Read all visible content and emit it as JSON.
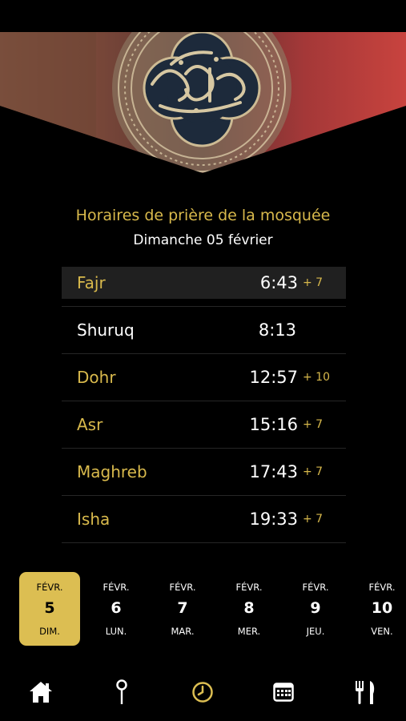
{
  "status_bar": {
    "time": ""
  },
  "header": {
    "title": "Horaires de prière de la mosquée",
    "date": "Dimanche 05 février"
  },
  "prayers": [
    {
      "name": "Fajr",
      "time": "6:43",
      "offset": "+ 7",
      "highlighted": true,
      "color": "#d8b94c"
    },
    {
      "name": "Shuruq",
      "time": "8:13",
      "offset": "",
      "highlighted": false,
      "color": "#ffffff"
    },
    {
      "name": "Dohr",
      "time": "12:57",
      "offset": "+ 10",
      "highlighted": false,
      "color": "#d8b94c"
    },
    {
      "name": "Asr",
      "time": "15:16",
      "offset": "+ 7",
      "highlighted": false,
      "color": "#d8b94c"
    },
    {
      "name": "Maghreb",
      "time": "17:43",
      "offset": "+ 7",
      "highlighted": false,
      "color": "#d8b94c"
    },
    {
      "name": "Isha",
      "time": "19:33",
      "offset": "+ 7",
      "highlighted": false,
      "color": "#d8b94c"
    }
  ],
  "days": [
    {
      "month": "FÉVR.",
      "day": "5",
      "weekday": "DIM.",
      "selected": true
    },
    {
      "month": "FÉVR.",
      "day": "6",
      "weekday": "LUN.",
      "selected": false
    },
    {
      "month": "FÉVR.",
      "day": "7",
      "weekday": "MAR.",
      "selected": false
    },
    {
      "month": "FÉVR.",
      "day": "8",
      "weekday": "MER.",
      "selected": false
    },
    {
      "month": "FÉVR.",
      "day": "9",
      "weekday": "JEU.",
      "selected": false
    },
    {
      "month": "FÉVR.",
      "day": "10",
      "weekday": "VEN.",
      "selected": false
    }
  ],
  "tabs": [
    {
      "icon": "home-icon",
      "active": false
    },
    {
      "icon": "map-pin-icon",
      "active": false
    },
    {
      "icon": "clock-icon",
      "active": true
    },
    {
      "icon": "calendar-icon",
      "active": false
    },
    {
      "icon": "restaurant-icon",
      "active": false
    }
  ],
  "colors": {
    "accent": "#d8b94c",
    "background": "#000000",
    "highlight_row": "#202020"
  }
}
